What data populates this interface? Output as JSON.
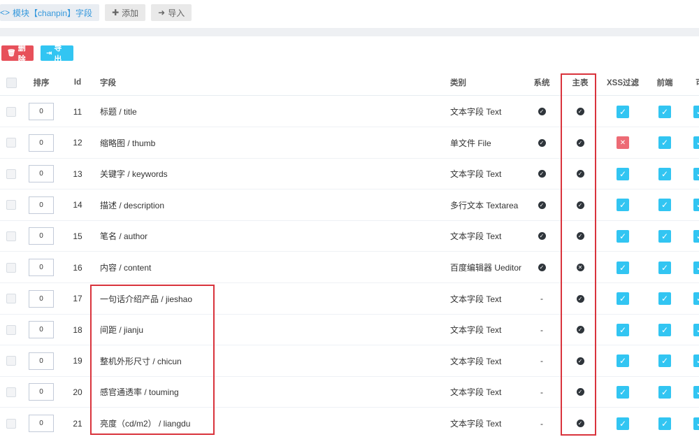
{
  "tabs": {
    "module": "模块【chanpin】字段",
    "add": "添加",
    "import": "导入"
  },
  "actions": {
    "delete": "删除",
    "export": "导出"
  },
  "columns": {
    "order": "排序",
    "id": "Id",
    "field": "字段",
    "type": "类别",
    "system": "系统",
    "main_table": "主表",
    "xss": "XSS过滤",
    "frontend": "前端",
    "extra": "可"
  },
  "rows": [
    {
      "order": "0",
      "id": "11",
      "field": "标题 / title",
      "type": "文本字段 Text",
      "system": "check",
      "main": "check",
      "xss": "on",
      "front": "on"
    },
    {
      "order": "0",
      "id": "12",
      "field": "缩略图 / thumb",
      "type": "单文件 File",
      "system": "check",
      "main": "check",
      "xss": "off",
      "front": "on"
    },
    {
      "order": "0",
      "id": "13",
      "field": "关键字 / keywords",
      "type": "文本字段 Text",
      "system": "check",
      "main": "check",
      "xss": "on",
      "front": "on"
    },
    {
      "order": "0",
      "id": "14",
      "field": "描述 / description",
      "type": "多行文本 Textarea",
      "system": "check",
      "main": "check",
      "xss": "on",
      "front": "on"
    },
    {
      "order": "0",
      "id": "15",
      "field": "笔名 / author",
      "type": "文本字段 Text",
      "system": "check",
      "main": "check",
      "xss": "on",
      "front": "on"
    },
    {
      "order": "0",
      "id": "16",
      "field": "内容 / content",
      "type": "百度编辑器 Ueditor",
      "system": "check",
      "main": "cross",
      "xss": "on",
      "front": "on"
    },
    {
      "order": "0",
      "id": "17",
      "field": "一句话介绍产品 / jieshao",
      "type": "文本字段 Text",
      "system": "-",
      "main": "check",
      "xss": "on",
      "front": "on"
    },
    {
      "order": "0",
      "id": "18",
      "field": "间距 / jianju",
      "type": "文本字段 Text",
      "system": "-",
      "main": "check",
      "xss": "on",
      "front": "on"
    },
    {
      "order": "0",
      "id": "19",
      "field": "整机外形尺寸 / chicun",
      "type": "文本字段 Text",
      "system": "-",
      "main": "check",
      "xss": "on",
      "front": "on"
    },
    {
      "order": "0",
      "id": "20",
      "field": "感官通透率 / touming",
      "type": "文本字段 Text",
      "system": "-",
      "main": "check",
      "xss": "on",
      "front": "on"
    },
    {
      "order": "0",
      "id": "21",
      "field": "亮度（cd/m2） / liangdu",
      "type": "文本字段 Text",
      "system": "-",
      "main": "check",
      "xss": "on",
      "front": "on"
    }
  ],
  "colors": {
    "accent_blue": "#32c5f2",
    "danger_red": "#e7505a",
    "highlight_red": "#d9333c",
    "dark": "#2f353b"
  }
}
